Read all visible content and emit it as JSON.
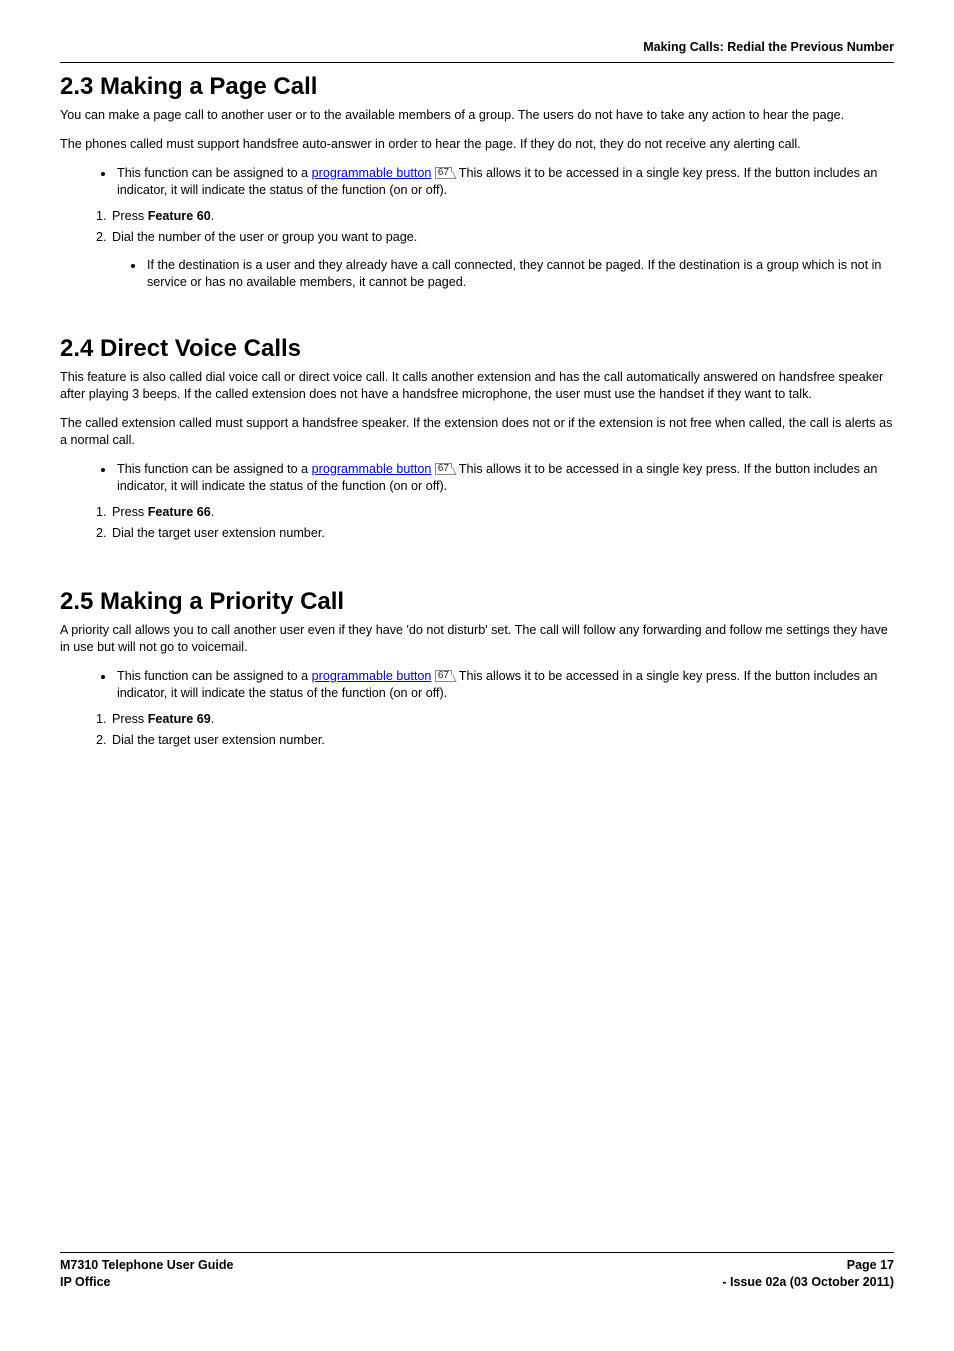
{
  "header": {
    "breadcrumb": "Making Calls: Redial the Previous Number"
  },
  "sections": {
    "s23": {
      "heading": "2.3 Making a Page Call",
      "p1": "You can make a page call to another user or to the available members of a group. The users do not have to take any action to hear the page.",
      "p2": "The phones called must support handsfree auto-answer in order to hear the page. If they do not, they do not receive any alerting call.",
      "bullet_prefix": "This function can be assigned to a ",
      "bullet_link": "programmable button",
      "bullet_ref": "67",
      "bullet_suffix": ". This allows it to be accessed in a single key press. If the button includes an indicator, it will indicate the status of the function (on or off).",
      "step1_prefix": "Press ",
      "step1_bold": "Feature 60",
      "step1_suffix": ".",
      "step2": "Dial the number of the user or group you want to page.",
      "sub_bullet": "If the destination is a user and they already have a call connected, they cannot be paged. If the destination is a group which is not in service or has no available members, it cannot be paged."
    },
    "s24": {
      "heading": "2.4 Direct Voice Calls",
      "p1": "This feature is also called dial voice call or direct voice call. It calls another extension and has the call automatically answered on handsfree speaker after playing 3 beeps. If the called extension does not have a handsfree microphone, the user must use the handset if they want to talk.",
      "p2": "The called extension called must support a handsfree speaker. If the extension does not or if the extension is not free when called, the call is alerts as a normal call.",
      "bullet_prefix": "This function can be assigned to a ",
      "bullet_link": "programmable button",
      "bullet_ref": "67",
      "bullet_suffix": ". This allows it to be accessed in a single key press. If the button includes an indicator, it will indicate the status of the function (on or off).",
      "step1_prefix": "Press ",
      "step1_bold": "Feature 66",
      "step1_suffix": ".",
      "step2": "Dial the target user extension number."
    },
    "s25": {
      "heading": "2.5 Making a Priority Call",
      "p1": "A priority call allows you to call another user even if they have 'do not disturb' set. The call will follow any forwarding and follow me settings they have in use but will not go to voicemail.",
      "bullet_prefix": "This function can be assigned to a ",
      "bullet_link": "programmable button",
      "bullet_ref": "67",
      "bullet_suffix": ". This allows it to be accessed in a single key press. If the button includes an indicator, it will indicate the status of the function (on or off).",
      "step1_prefix": "Press ",
      "step1_bold": "Feature 69",
      "step1_suffix": ".",
      "step2": "Dial the target user extension number."
    }
  },
  "footer": {
    "left1": "M7310 Telephone User Guide",
    "left2": "IP Office",
    "right1": "Page 17",
    "right2": "- Issue 02a (03 October 2011)"
  }
}
